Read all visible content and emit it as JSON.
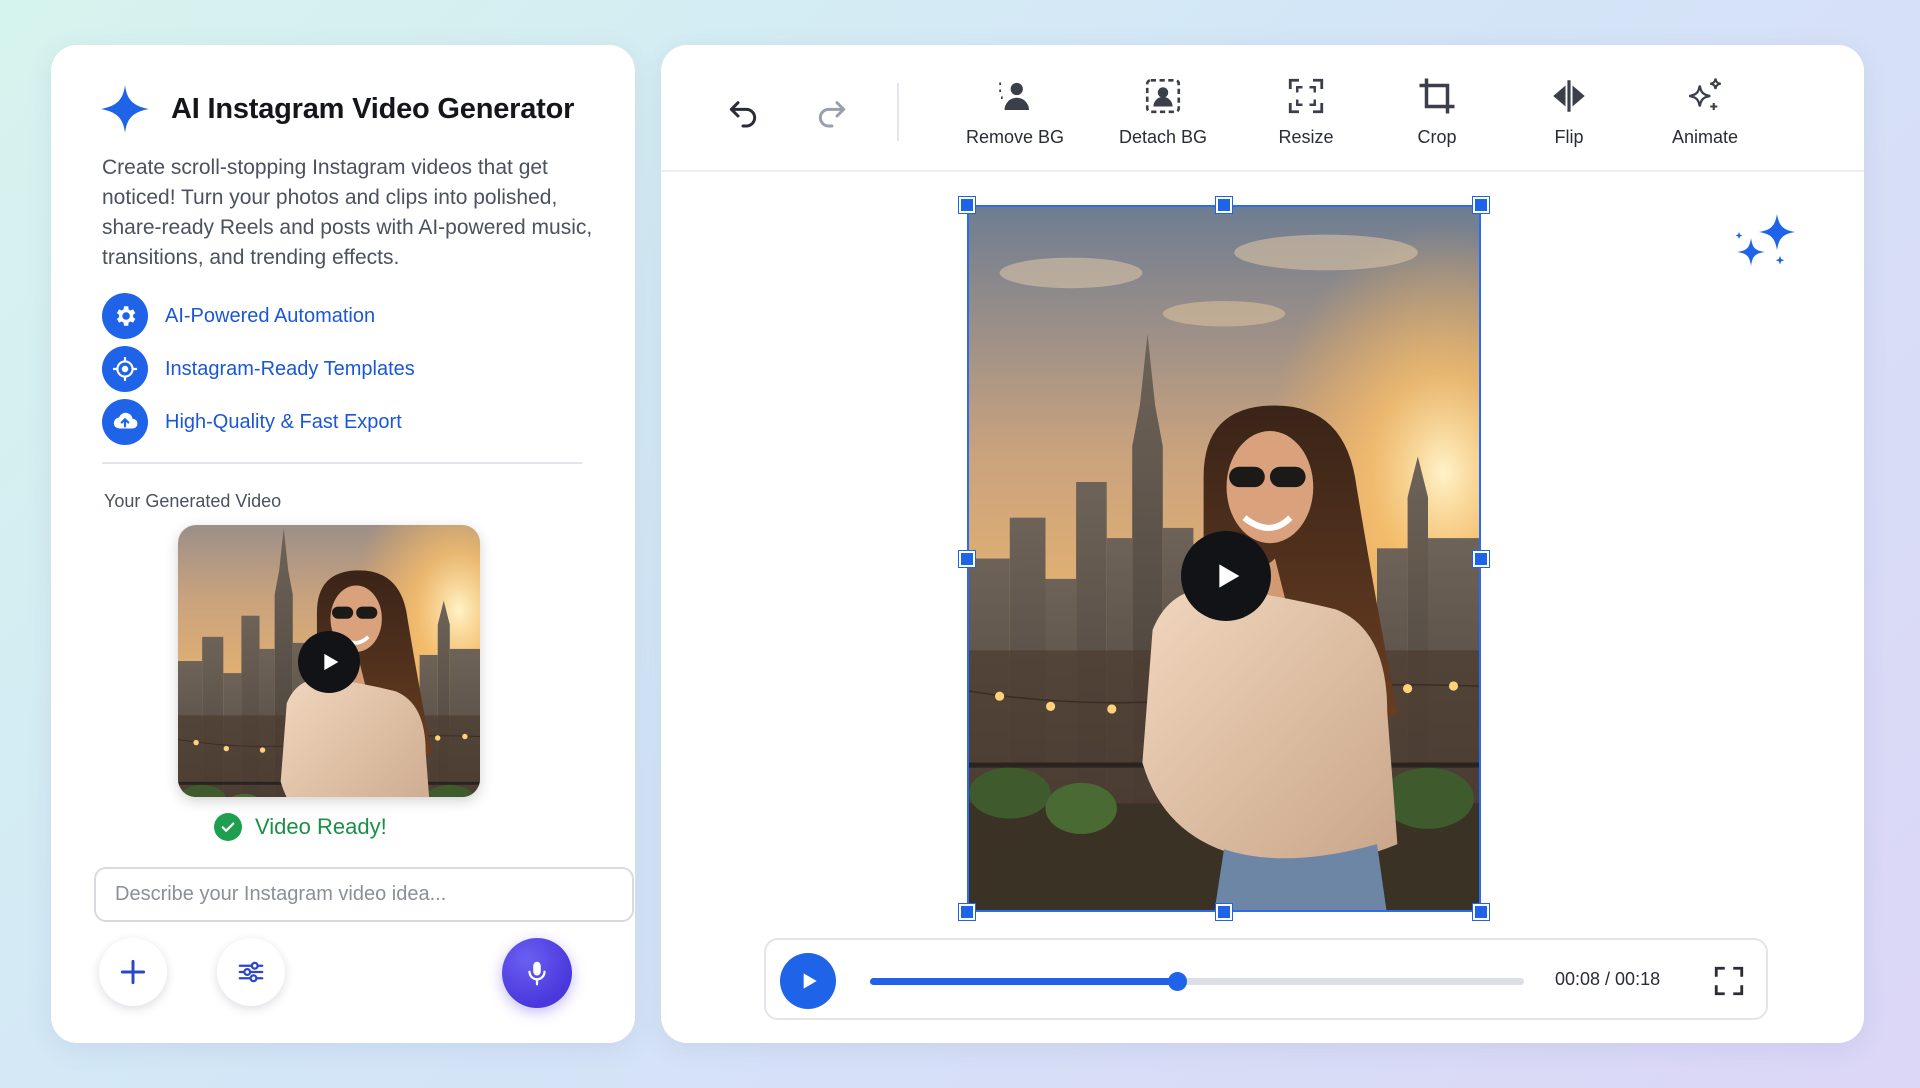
{
  "app": {
    "title": "AI Instagram Video Generator",
    "description": "Create scroll-stopping Instagram videos that get noticed! Turn your photos and clips into polished, share-ready Reels and posts with AI-powered music, transitions, and trending effects.",
    "logo_icon": "sparkle-icon",
    "accent_color": "#1f63e8"
  },
  "features": [
    {
      "icon": "gear-icon",
      "label": "AI-Powered Automation"
    },
    {
      "icon": "target-icon",
      "label": "Instagram-Ready Templates"
    },
    {
      "icon": "cloud-upload-icon",
      "label": "High-Quality & Fast Export"
    }
  ],
  "generated": {
    "label": "Your Generated Video",
    "status": "Video Ready!",
    "status_color": "#1a8f45"
  },
  "prompt": {
    "placeholder": "Describe your Instagram video idea...",
    "value": ""
  },
  "bottom_buttons": {
    "add_icon": "plus-icon",
    "settings_icon": "sliders-icon",
    "mic_icon": "microphone-icon"
  },
  "toolbar": {
    "undo_icon": "undo-icon",
    "redo_icon": "redo-icon",
    "tools": [
      {
        "icon": "person-remove-icon",
        "label": "Remove BG"
      },
      {
        "icon": "person-frame-icon",
        "label": "Detach BG"
      },
      {
        "icon": "resize-icon",
        "label": "Resize"
      },
      {
        "icon": "crop-icon",
        "label": "Crop"
      },
      {
        "icon": "flip-icon",
        "label": "Flip"
      },
      {
        "icon": "magic-sparkle-icon",
        "label": "Animate"
      }
    ]
  },
  "player": {
    "time": "00:08 / 00:18",
    "progress": 0.47,
    "play_icon": "play-icon",
    "fullscreen_icon": "fullscreen-icon"
  }
}
